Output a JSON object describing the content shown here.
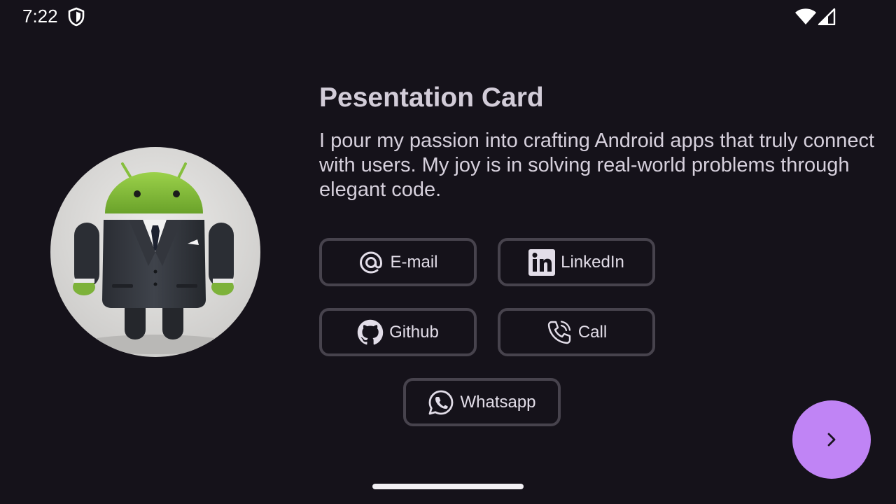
{
  "status_bar": {
    "time": "7:22",
    "left_icons": [
      "shield-icon"
    ],
    "right_icons": [
      "wifi-icon",
      "signal-icon"
    ]
  },
  "profile": {
    "avatar_icon": "android-robot-in-suit-avatar"
  },
  "card": {
    "title": "Pesentation Card",
    "description": "I pour my passion into crafting Android apps that truly connect with users. My joy is in solving real-world problems through elegant code."
  },
  "contacts": {
    "email": {
      "label": "E-mail",
      "icon": "at-sign-icon"
    },
    "linkedin": {
      "label": "LinkedIn",
      "icon": "linkedin-icon"
    },
    "github": {
      "label": "Github",
      "icon": "github-icon"
    },
    "call": {
      "label": "Call",
      "icon": "phone-icon"
    },
    "whatsapp": {
      "label": "Whatsapp",
      "icon": "whatsapp-icon"
    }
  },
  "fab": {
    "icon": "chevron-right-icon"
  },
  "colors": {
    "background": "#15121a",
    "accent": "#c084f5",
    "button_border": "#47434d",
    "text": "#d6d0dc"
  }
}
